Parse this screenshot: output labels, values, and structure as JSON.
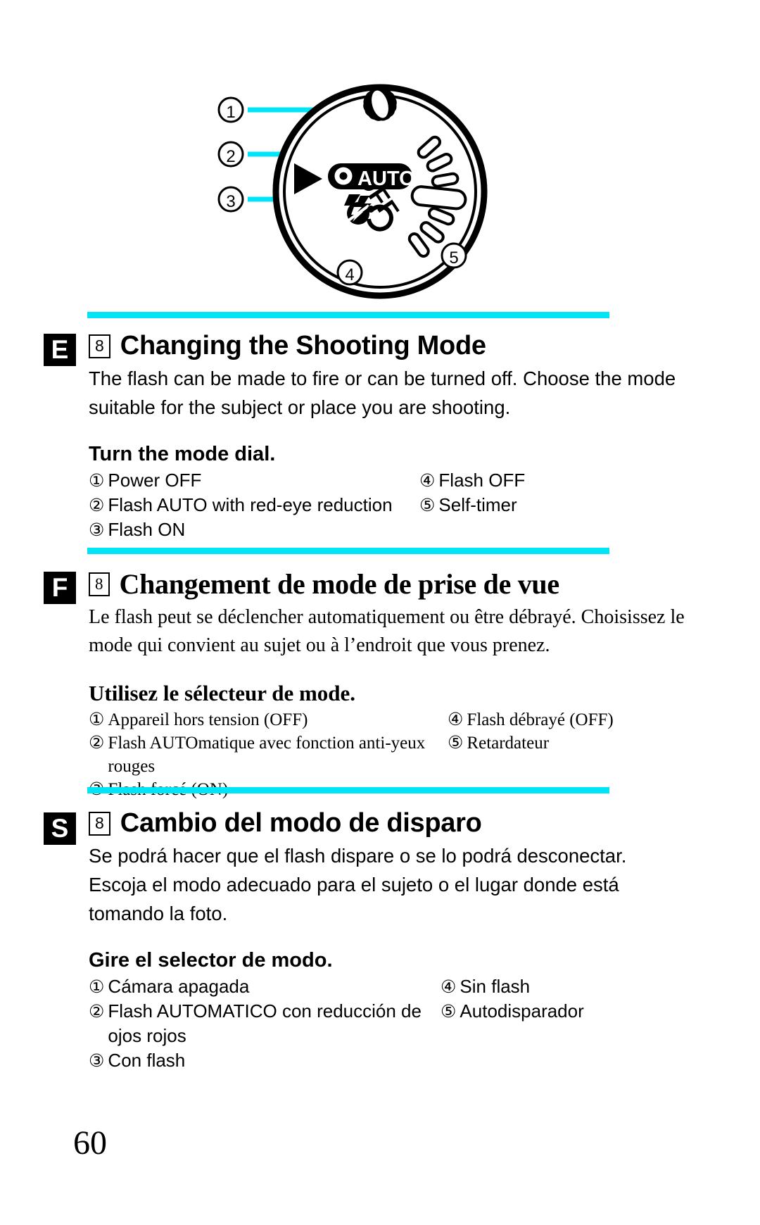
{
  "figure": {
    "label": "camera-mode-dial-diagram",
    "dial_labels": {
      "off": "OFF",
      "auto": "AUTO"
    },
    "callouts": [
      "1",
      "2",
      "3",
      "4",
      "5"
    ],
    "accent_color": "#00e5f5"
  },
  "page": {
    "number": "60"
  },
  "sections": [
    {
      "lang_badge": "E",
      "step": "8",
      "title": "Changing the Shooting Mode",
      "body": "The flash can be made to fire or can be turned off. Choose the mode suitable for the subject or place you are shooting.",
      "subhead": "Turn the mode dial.",
      "options": [
        {
          "num": "①",
          "label": "Power OFF"
        },
        {
          "num": "②",
          "label": "Flash AUTO with red-eye reduction"
        },
        {
          "num": "③",
          "label": "Flash ON"
        },
        {
          "num": "④",
          "label": "Flash OFF"
        },
        {
          "num": "⑤",
          "label": "Self-timer"
        }
      ]
    },
    {
      "lang_badge": "F",
      "step": "8",
      "title": "Changement de mode de prise de vue",
      "body": "Le flash peut se déclencher automatiquement ou être débrayé. Choisissez le mode qui convient au sujet ou à l’endroit que vous prenez.",
      "subhead": "Utilisez le sélecteur de mode.",
      "options": [
        {
          "num": "①",
          "label": "Appareil hors tension (OFF)"
        },
        {
          "num": "②",
          "label": "Flash AUTOmatique avec fonction anti-yeux rouges"
        },
        {
          "num": "③",
          "label": "Flash forcé (ON)"
        },
        {
          "num": "④",
          "label": "Flash débrayé (OFF)"
        },
        {
          "num": "⑤",
          "label": "Retardateur"
        }
      ]
    },
    {
      "lang_badge": "S",
      "step": "8",
      "title": "Cambio del modo de disparo",
      "body": "Se podrá hacer que el flash dispare o se lo podrá desconectar. Escoja el modo adecuado para el sujeto o el lugar donde está tomando la foto.",
      "subhead": "Gire el selector de modo.",
      "options": [
        {
          "num": "①",
          "label": "Cámara apagada"
        },
        {
          "num": "②",
          "label": "Flash AUTOMATICO con reducción de ojos rojos"
        },
        {
          "num": "③",
          "label": "Con flash"
        },
        {
          "num": "④",
          "label": "Sin flash"
        },
        {
          "num": "⑤",
          "label": "Autodisparador"
        }
      ]
    }
  ]
}
